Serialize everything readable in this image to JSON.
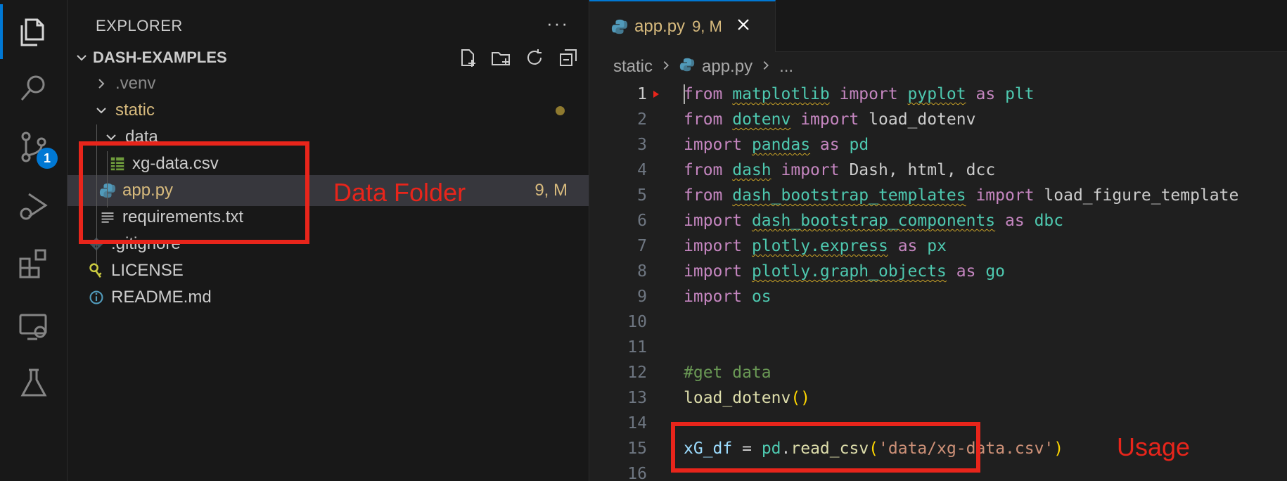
{
  "explorer": {
    "title": "EXPLORER",
    "more": "···",
    "project": "DASH-EXAMPLES",
    "tree": {
      "venv": ".venv",
      "static": "static",
      "data": "data",
      "xg_csv": "xg-data.csv",
      "app_py": "app.py",
      "app_status": "9, M",
      "requirements": "requirements.txt",
      "gitignore": ".gitignore",
      "license": "LICENSE",
      "readme": "README.md"
    }
  },
  "activity": {
    "scm_badge": "1"
  },
  "editor": {
    "tab_label": "app.py",
    "tab_status": "9, M",
    "breadcrumbs": [
      "static",
      "app.py",
      "..."
    ],
    "line_numbers": [
      "1",
      "2",
      "3",
      "4",
      "5",
      "6",
      "7",
      "8",
      "9",
      "10",
      "11",
      "12",
      "13",
      "14",
      "15",
      "16"
    ]
  },
  "annotations": {
    "data_folder": "Data Folder",
    "usage": "Usage"
  },
  "colors": {
    "accent": "#0078d4",
    "annotation_red": "#e8251b",
    "modified": "#c9a227"
  }
}
